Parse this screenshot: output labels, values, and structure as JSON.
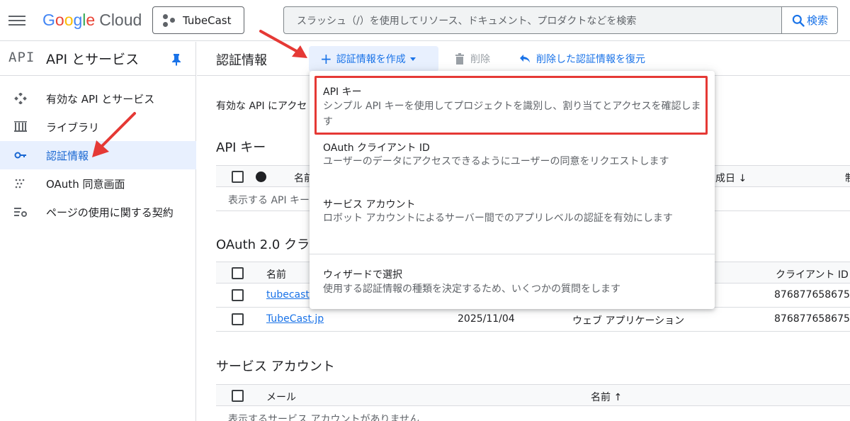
{
  "topbar": {
    "logo": {
      "g": "G",
      "o1": "o",
      "o2": "o",
      "g2": "g",
      "l": "l",
      "e": "e",
      "cloud": "Cloud"
    },
    "project": "TubeCast",
    "search_placeholder": "スラッシュ（/）を使用してリソース、ドキュメント、プロダクトなどを検索",
    "search_button": "検索"
  },
  "sidebar": {
    "badge": "API",
    "title": "API とサービス",
    "items": [
      {
        "label": "有効な API とサービス",
        "icon": "diamond-dots-icon"
      },
      {
        "label": "ライブラリ",
        "icon": "library-icon"
      },
      {
        "label": "認証情報",
        "icon": "key-icon",
        "active": true
      },
      {
        "label": "OAuth 同意画面",
        "icon": "dots-grid-icon"
      },
      {
        "label": "ページの使用に関する契約",
        "icon": "settings-list-icon"
      }
    ]
  },
  "toolbar": {
    "page_title": "認証情報",
    "create_label": "認証情報を作成",
    "delete_label": "削除",
    "restore_label": "削除した認証情報を復元"
  },
  "main": {
    "intro": "有効な API にアクセ",
    "api_keys": {
      "title": "API キー",
      "col_name": "名前",
      "col_date": "成日",
      "col_extra": "制",
      "empty": "表示する API キー"
    },
    "oauth": {
      "title": "OAuth 2.0 クラ",
      "col_name": "名前",
      "col_client_id": "クライアント ID",
      "rows": [
        {
          "name": "tubecast-",
          "date": "",
          "type": "",
          "client_id": "876877658675"
        },
        {
          "name": "TubeCast.jp",
          "date": "2025/11/04",
          "type": "ウェブ アプリケーション",
          "client_id": "876877658675"
        }
      ]
    },
    "service_accounts": {
      "title": "サービス アカウント",
      "col_email": "メール",
      "col_name": "名前",
      "empty": "表示するサービス アカウントがありません"
    }
  },
  "dropdown": {
    "items": [
      {
        "title": "API キー",
        "desc": "シンプル API キーを使用してプロジェクトを識別し、割り当てとアクセスを確認します"
      },
      {
        "title": "OAuth クライアント ID",
        "desc": "ユーザーのデータにアクセスできるようにユーザーの同意をリクエストします"
      },
      {
        "title": "サービス アカウント",
        "desc": "ロボット アカウントによるサーバー間でのアプリレベルの認証を有効にします"
      },
      {
        "title": "ウィザードで選択",
        "desc": "使用する認証情報の種類を決定するため、いくつかの質問をします"
      }
    ]
  },
  "colors": {
    "accent": "#1a73e8",
    "annotation": "#e53935",
    "active_bg": "#e8f0fe"
  }
}
